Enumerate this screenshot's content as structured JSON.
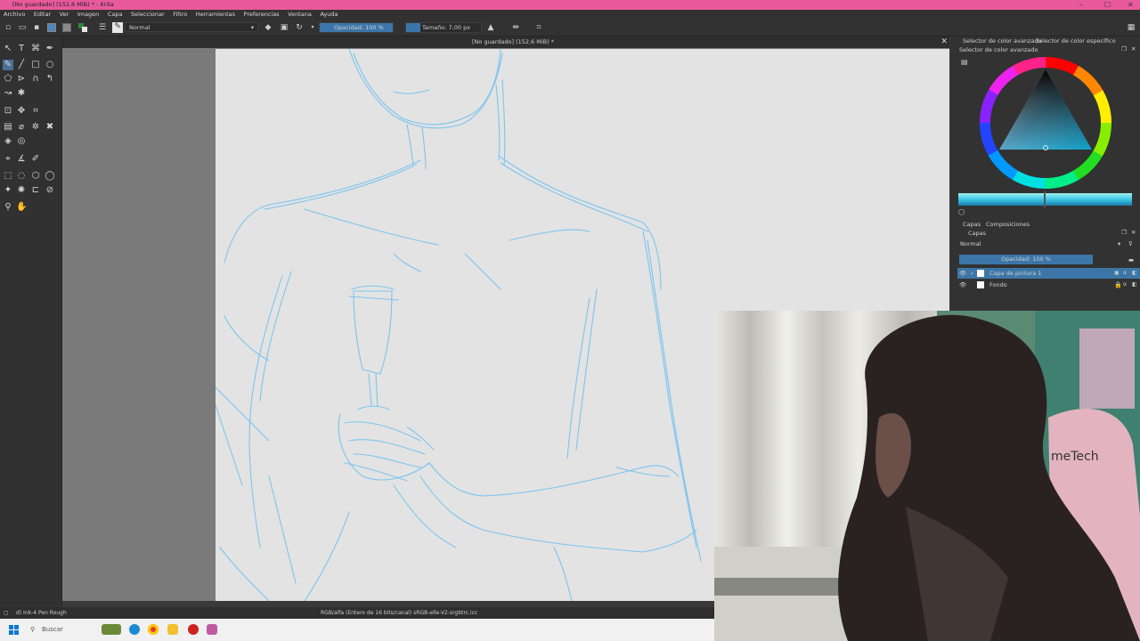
{
  "window": {
    "title": "[No guardado]  (152,6 MiB) * - Krita",
    "controls": [
      "–",
      "☐",
      "✕"
    ]
  },
  "menu": [
    "Archivo",
    "Editar",
    "Ver",
    "Imagen",
    "Capa",
    "Seleccionar",
    "Filtro",
    "Herramientas",
    "Preferencias",
    "Ventana",
    "Ayuda"
  ],
  "toolbar": {
    "blend_mode": "Normal",
    "opacity_label": "Opacidad: 100 %",
    "opacity_value": 1.0,
    "size_label": "Tamaño: 7,00 px"
  },
  "document": {
    "tab_title": "[No guardado]  (152,6 MiB) *"
  },
  "color_docker": {
    "tabs": [
      "Selector de color avanzado",
      "Selector de color específico"
    ],
    "panel_title": "Selector de color avanzado",
    "selected_color": "#4a9fc8"
  },
  "layers_docker": {
    "tabs": [
      "Capas",
      "Composiciones"
    ],
    "panel_title": "Capas",
    "blend_mode": "Normal",
    "opacity_label": "Opacidad: 100 %",
    "layers": [
      {
        "name": "Capa de pintura 1",
        "selected": true
      },
      {
        "name": "Fondo",
        "selected": false
      }
    ]
  },
  "status": {
    "brush": "d) Ink-4 Pen Rough",
    "color_profile": "RGB/alfa (Entero de 16 bits/canal)  sRGB-elle-V2-srgbtrc.icc"
  },
  "taskbar": {
    "search_placeholder": "Buscar"
  },
  "colors": {
    "titlebar": "#e85a9c",
    "accent": "#3c76a8",
    "sketch": "#7cc4ee"
  },
  "webcam": {
    "chair_text": "meTech"
  }
}
